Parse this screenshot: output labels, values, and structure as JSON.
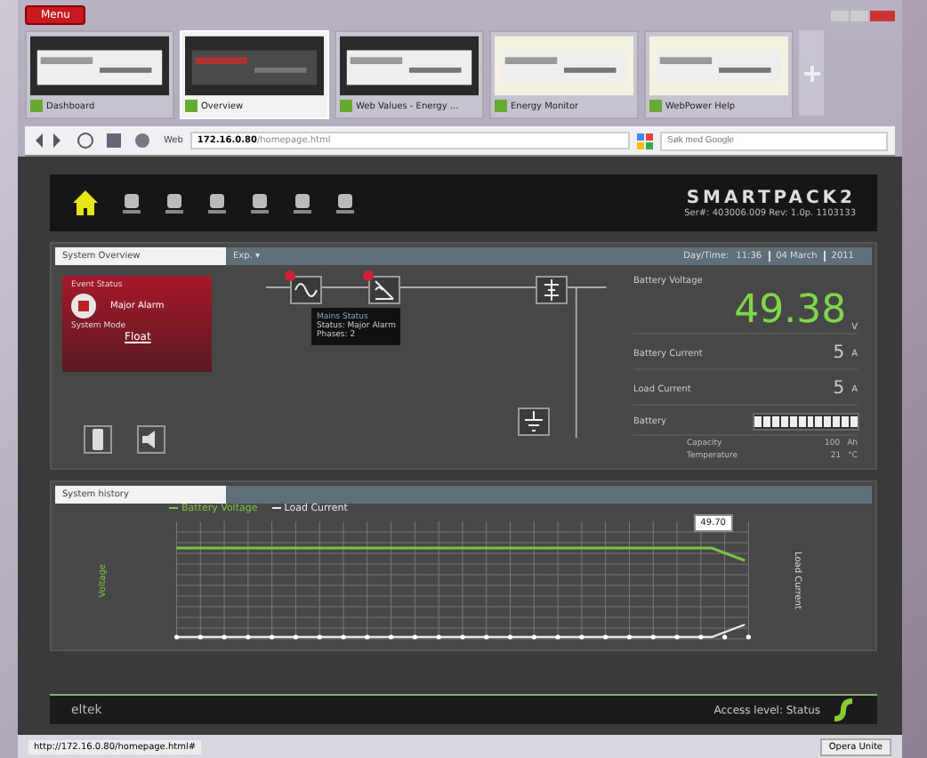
{
  "browser": {
    "menu_label": "Menu",
    "tabs": [
      {
        "title": "Dashboard",
        "selected": false
      },
      {
        "title": "Overview",
        "selected": true
      },
      {
        "title": "Web Values - Energy ...",
        "selected": false
      },
      {
        "title": "Energy Monitor",
        "selected": false
      },
      {
        "title": "WebPower Help",
        "selected": false
      }
    ],
    "site_label": "Web",
    "address_host": "172.16.0.80",
    "address_path": "/homepage.html",
    "search_placeholder": "Søk med Google"
  },
  "header": {
    "logo": "SMARTPACK2",
    "serial": "Ser#: 403006.009 Rev: 1.0p. 1103133"
  },
  "overview": {
    "title": "System Overview",
    "menu": "Exp. ▾",
    "date_label": "Day/Time:",
    "time": "11:36",
    "date": "04 March",
    "year": "2011",
    "event_status_label": "Event Status",
    "event_status": "Major Alarm",
    "system_mode_label": "System Mode",
    "system_mode": "Float",
    "tooltip": {
      "title": "Mains Status",
      "lines": [
        "Status: Major Alarm",
        "Phases: 2"
      ]
    },
    "battery_voltage_label": "Battery Voltage",
    "battery_voltage": "49.38",
    "battery_voltage_unit": "V",
    "readings": [
      {
        "label": "Battery Current",
        "value": "5",
        "unit": "A"
      },
      {
        "label": "Load Current",
        "value": "5",
        "unit": "A"
      }
    ],
    "battery_label": "Battery",
    "battery_bar": {
      "level": 1
    },
    "battery_details": [
      {
        "label": "Capacity",
        "value": "100",
        "unit": "Ah"
      },
      {
        "label": "Temperature",
        "value": "21",
        "unit": "°C"
      }
    ]
  },
  "history": {
    "title": "System history",
    "legend": [
      {
        "name": "Battery Voltage",
        "color": "#7fc241"
      },
      {
        "name": "Load Current",
        "color": "#e8e8e8"
      }
    ],
    "y_label": "Voltage",
    "y2_label": "Load Current",
    "tooltip": "49.70"
  },
  "footer": {
    "brand": "eltek",
    "access": "Access level: Status"
  },
  "status_bar": {
    "url": "http://172.16.0.80/homepage.html#",
    "right": "Opera Unite"
  }
}
